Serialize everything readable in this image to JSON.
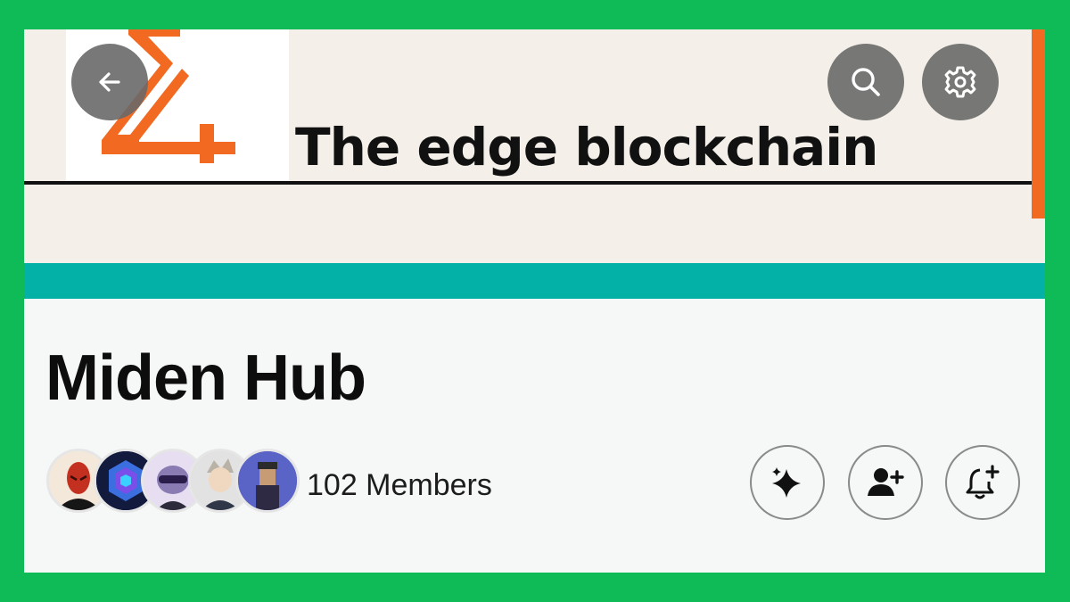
{
  "banner": {
    "title": "The edge blockchain",
    "colors": {
      "orange": "#f26a21",
      "teal": "#04b1a7",
      "cream": "#f4f0e9"
    }
  },
  "nav": {
    "back_icon": "arrow-left-icon",
    "search_icon": "search-icon",
    "settings_icon": "gear-icon"
  },
  "group": {
    "name": "Miden Hub",
    "members_label": "102 Members",
    "member_avatars": [
      "avatar-1",
      "avatar-2",
      "avatar-3",
      "avatar-4",
      "avatar-5"
    ]
  },
  "actions": {
    "sparkle_icon": "sparkle-icon",
    "add_member_icon": "add-person-icon",
    "notify_icon": "bell-plus-icon"
  },
  "page": {
    "border_color": "#0fbb57"
  }
}
